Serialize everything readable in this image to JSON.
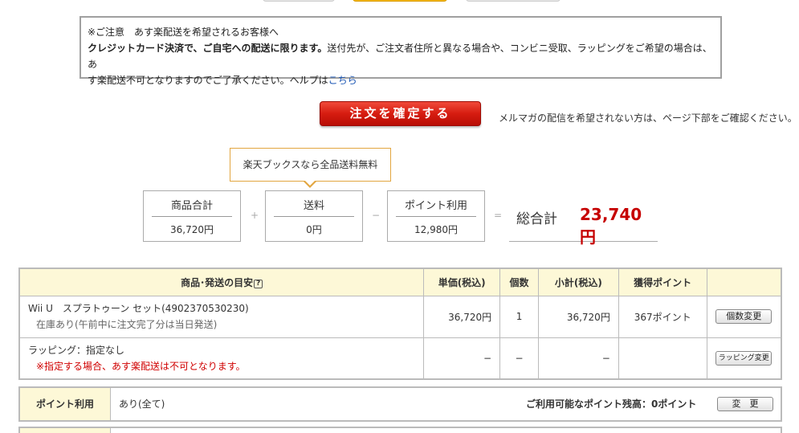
{
  "notice": {
    "line1": "※ご注意　あす楽配送を希望されるお客様へ",
    "bold_text": "クレジットカード決済で、ご自宅への配送に限ります。",
    "text1": "送付先が、ご注文者住所と異なる場合や、コンビニ受取、ラッピングをご希望の場合は、あ",
    "text2": "す楽配送不可となりますのでご了承ください。ヘルプは",
    "help_link": "こちら"
  },
  "confirm_button": "注文を確定する",
  "mailmag_note": "メルマガの配信を希望されない方は、ページ下部をご確認ください。",
  "shipping_tooltip": "楽天ブックスなら全品送料無料",
  "summary": {
    "product_total_label": "商品合計",
    "product_total_value": "36,720円",
    "shipping_label": "送料",
    "shipping_value": "0円",
    "point_label": "ポイント利用",
    "point_value": "12,980円",
    "op_plus": "+",
    "op_minus": "−",
    "op_equals": "=",
    "grand_total_label": "総合計",
    "grand_total_value": "23,740円"
  },
  "table": {
    "headers": {
      "product": "商品･発送の目安",
      "help_icon": "?",
      "unit_price": "単価(税込)",
      "quantity": "個数",
      "subtotal": "小計(税込)",
      "points": "獲得ポイント"
    },
    "item": {
      "name": "Wii U　スプラトゥーン セット(4902370530230)",
      "stock": "在庫あり(午前中に注文完了分は当日発送)",
      "unit_price": "36,720円",
      "quantity": "1",
      "subtotal": "36,720円",
      "points": "367ポイント",
      "button": "個数変更"
    },
    "wrapping": {
      "label": "ラッピング：指定なし",
      "warning": "※指定する場合、あす楽配送は不可となります。",
      "unit_price": "−",
      "quantity": "−",
      "subtotal": "−",
      "button": "ラッピング変更"
    }
  },
  "point_usage": {
    "label": "ポイント利用",
    "value": "あり(全て)",
    "remaining": "ご利用可能なポイント残高：0ポイント",
    "button": "変　更"
  }
}
